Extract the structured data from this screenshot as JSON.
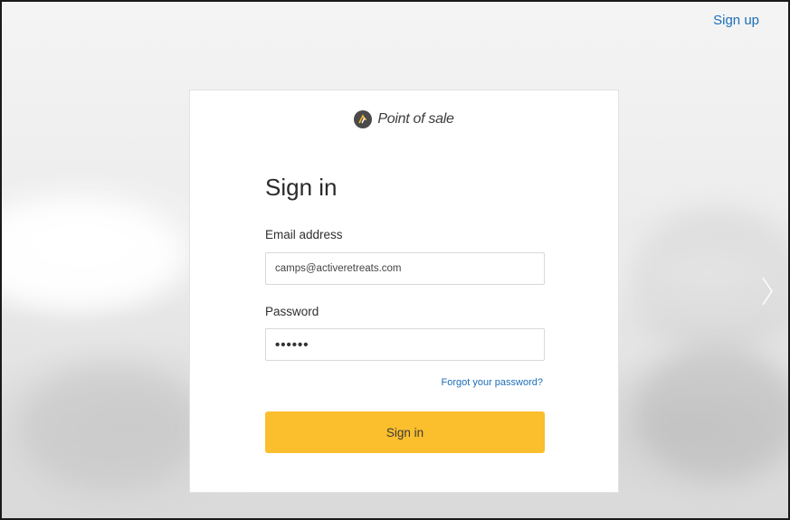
{
  "header": {
    "signup_label": "Sign up"
  },
  "brand": {
    "logo_icon": "brand-logo-icon",
    "name": "Point of sale"
  },
  "form": {
    "title": "Sign in",
    "email": {
      "label": "Email address",
      "value": "camps@activeretreats.com"
    },
    "password": {
      "label": "Password",
      "value": "••••••"
    },
    "forgot_label": "Forgot your password?",
    "submit_label": "Sign in"
  },
  "colors": {
    "accent_button": "#fbbe2c",
    "link": "#1b6fb8"
  }
}
